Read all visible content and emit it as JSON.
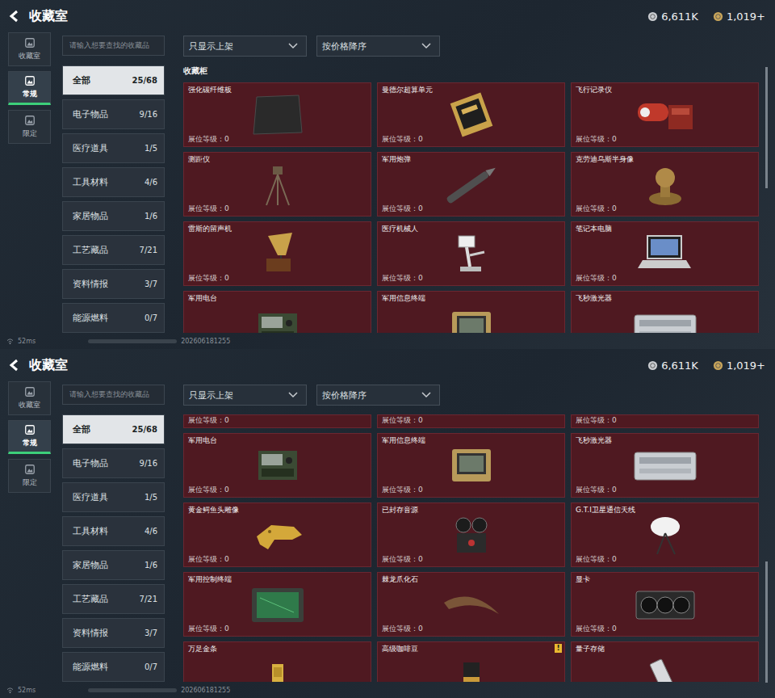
{
  "panels": [
    {
      "title": "收藏室",
      "currencies": [
        {
          "value": "6,611K",
          "color": "#c9ccd0"
        },
        {
          "value": "1,019+",
          "color": "#c8a55a"
        }
      ],
      "nav": [
        {
          "label": "收藏室",
          "selected": false
        },
        {
          "label": "常规",
          "selected": true
        },
        {
          "label": "限定",
          "selected": false
        }
      ],
      "search": {
        "placeholder": "请输入想要查找的收藏品"
      },
      "filters": [
        {
          "label": "只显示上架"
        },
        {
          "label": "按价格降序"
        }
      ],
      "categories": [
        {
          "label": "全部",
          "count": "25/68",
          "selected": true
        },
        {
          "label": "电子物品",
          "count": "9/16",
          "selected": false
        },
        {
          "label": "医疗道具",
          "count": "1/5",
          "selected": false
        },
        {
          "label": "工具材料",
          "count": "4/6",
          "selected": false
        },
        {
          "label": "家居物品",
          "count": "1/6",
          "selected": false
        },
        {
          "label": "工艺藏品",
          "count": "7/21",
          "selected": false
        },
        {
          "label": "资料情报",
          "count": "3/7",
          "selected": false
        },
        {
          "label": "能源燃料",
          "count": "0/7",
          "selected": false
        }
      ],
      "section": "收藏柜",
      "scroll_level": 0,
      "cards": [
        {
          "name": "强化碳纤维板",
          "booth": "展位等级：0",
          "partial": false
        },
        {
          "name": "曼德尔超算单元",
          "booth": "展位等级：0",
          "partial": false
        },
        {
          "name": "飞行记录仪",
          "booth": "展位等级：0",
          "partial": false
        },
        {
          "name": "测距仪",
          "booth": "展位等级：0",
          "partial": false
        },
        {
          "name": "军用炮弹",
          "booth": "展位等级：0",
          "partial": false
        },
        {
          "name": "克劳迪乌斯半身像",
          "booth": "展位等级：0",
          "partial": false
        },
        {
          "name": "雷斯的留声机",
          "booth": "展位等级：0",
          "partial": false
        },
        {
          "name": "医疗机械人",
          "booth": "展位等级：0",
          "partial": false
        },
        {
          "name": "笔记本电脑",
          "booth": "展位等级：0",
          "partial": false
        },
        {
          "name": "军用电台",
          "partial": false
        },
        {
          "name": "军用信息终端",
          "partial": false
        },
        {
          "name": "飞秒激光器",
          "partial": false
        }
      ],
      "status": {
        "ping": "52ms",
        "build": "202606181255"
      }
    },
    {
      "title": "收藏室",
      "currencies": [
        {
          "value": "6,611K",
          "color": "#c9ccd0"
        },
        {
          "value": "1,019+",
          "color": "#c8a55a"
        }
      ],
      "nav": [
        {
          "label": "收藏室",
          "selected": false
        },
        {
          "label": "常规",
          "selected": true
        },
        {
          "label": "限定",
          "selected": false
        }
      ],
      "search": {
        "placeholder": "请输入想要查找的收藏品"
      },
      "filters": [
        {
          "label": "只显示上架"
        },
        {
          "label": "按价格降序"
        }
      ],
      "categories": [
        {
          "label": "全部",
          "count": "25/68",
          "selected": true
        },
        {
          "label": "电子物品",
          "count": "9/16",
          "selected": false
        },
        {
          "label": "医疗道具",
          "count": "1/5",
          "selected": false
        },
        {
          "label": "工具材料",
          "count": "4/6",
          "selected": false
        },
        {
          "label": "家居物品",
          "count": "1/6",
          "selected": false
        },
        {
          "label": "工艺藏品",
          "count": "7/21",
          "selected": false
        },
        {
          "label": "资料情报",
          "count": "3/7",
          "selected": false
        },
        {
          "label": "能源燃料",
          "count": "0/7",
          "selected": false
        }
      ],
      "scroll_level": 1,
      "cards": [
        {
          "booth": "展位等级：0",
          "partial": true
        },
        {
          "booth": "展位等级：0",
          "partial": true
        },
        {
          "booth": "展位等级：0",
          "partial": true
        },
        {
          "name": "军用电台",
          "booth": "展位等级：0",
          "partial": false
        },
        {
          "name": "军用信息终端",
          "booth": "展位等级：0",
          "partial": false
        },
        {
          "name": "飞秒激光器",
          "booth": "展位等级：0",
          "partial": false
        },
        {
          "name": "黄金鳄鱼头雕像",
          "booth": "展位等级：0",
          "partial": false
        },
        {
          "name": "已封存音源",
          "booth": "展位等级：0",
          "partial": false
        },
        {
          "name": "G.T.I卫星通信天线",
          "booth": "展位等级：0",
          "partial": false
        },
        {
          "name": "军用控制终端",
          "booth": "展位等级：0",
          "partial": false
        },
        {
          "name": "棘龙爪化石",
          "booth": "展位等级：0",
          "partial": false
        },
        {
          "name": "显卡",
          "booth": "展位等级：0",
          "partial": false
        },
        {
          "name": "万足金条",
          "partial": false
        },
        {
          "name": "高级咖啡豆",
          "badge": "!",
          "partial": false
        },
        {
          "name": "量子存储",
          "partial": false
        }
      ],
      "status": {
        "ping": "52ms",
        "build": "202606181255"
      }
    }
  ]
}
